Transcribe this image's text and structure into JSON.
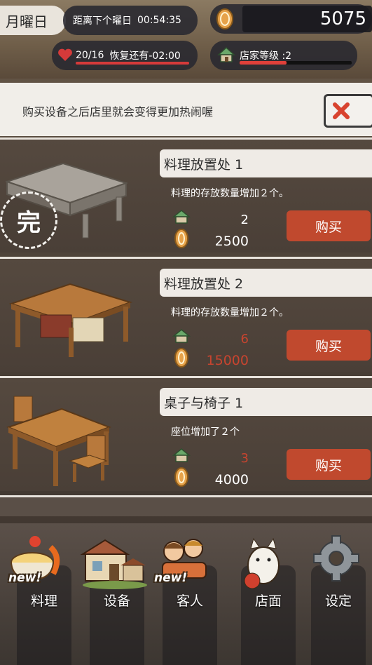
{
  "header": {
    "weekday": "月曜日",
    "countdown_label": "距离下个曜日",
    "countdown_time": "00:54:35",
    "coins": "5075",
    "stamina": "20/16",
    "recovery_text": "恢复还有-02:00",
    "shop_level_text": "店家等级 :2",
    "shop_level_progress": 0.42
  },
  "banner": {
    "text": "购买设备之后店里就会变得更加热闹喔"
  },
  "items": [
    {
      "title": "料理放置处 1",
      "description": "料理的存放数量增加２个。",
      "level_required": "2",
      "price": "2500",
      "buy_label": "购买",
      "complete_stamp": "完",
      "affordable": true
    },
    {
      "title": "料理放置处 2",
      "description": "料理的存放数量增加２个。",
      "level_required": "6",
      "price": "15000",
      "buy_label": "购买",
      "affordable": false
    },
    {
      "title": "桌子与椅子 1",
      "description": "座位增加了２个",
      "level_required": "3",
      "price": "4000",
      "buy_label": "购买",
      "level_insufficient": true
    }
  ],
  "nav": {
    "items": [
      {
        "label": "料理",
        "badge": "new!"
      },
      {
        "label": "设备"
      },
      {
        "label": "客人",
        "badge": "new!"
      },
      {
        "label": "店面"
      },
      {
        "label": "设定"
      }
    ]
  },
  "colors": {
    "buy_button": "#c0492e",
    "insufficient_text": "#c8442f",
    "heart": "#d63a3a"
  }
}
